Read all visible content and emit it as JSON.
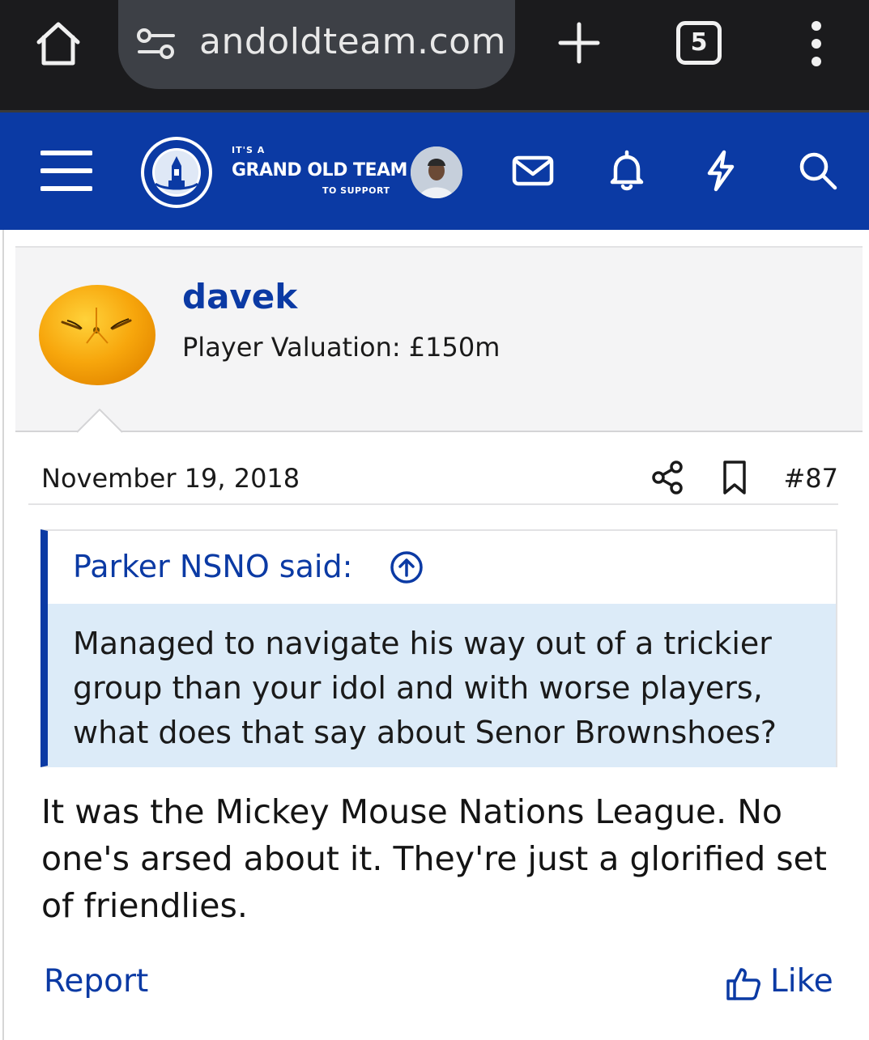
{
  "browser": {
    "url": "andoldteam.com",
    "tab_count": "5",
    "home_icon": "home-icon",
    "tune_icon": "site-settings-icon",
    "new_tab_icon": "plus-icon",
    "menu_icon": "kebab-menu-icon"
  },
  "site": {
    "logo": {
      "line1": "IT'S A",
      "line2": "GRAND OLD TEAM",
      "line3": "TO SUPPORT"
    },
    "brand_color": "#0b3aa4",
    "icons": [
      "hamburger-icon",
      "envelope-icon",
      "bell-icon",
      "bolt-icon",
      "search-icon"
    ]
  },
  "post": {
    "username": "davek",
    "valuation": "Player Valuation: £150m",
    "date": "November 19, 2018",
    "post_number": "#87",
    "quote": {
      "author": "Parker NSNO said:",
      "text": "Managed to navigate his way out of a trickier group than your idol and with worse players, what does that say about Senor Brownshoes?"
    },
    "message": "It was the Mickey Mouse Nations League. No one's arsed about it. They're just a glorified set of friendlies.",
    "actions": {
      "report": "Report",
      "like": "Like"
    }
  }
}
